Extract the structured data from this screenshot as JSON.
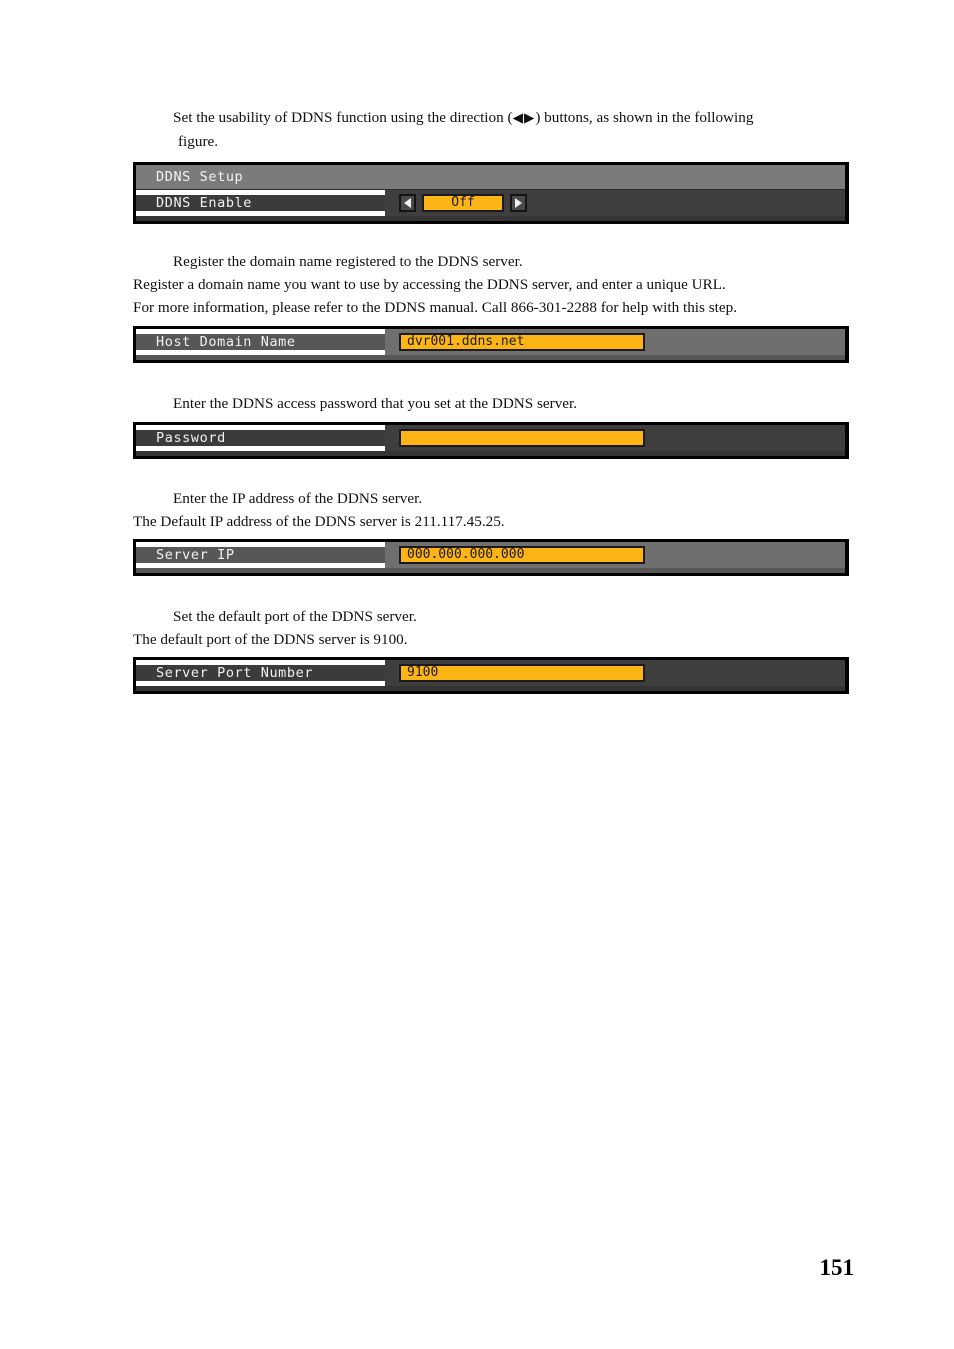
{
  "document": {
    "page_number": "151"
  },
  "sections": [
    {
      "id": "ddns-enable",
      "paragraph_lines": [
        "Set the usability of DDNS function using the direction (◀ ▶) buttons, as shown in the following",
        "figure."
      ],
      "para_pre": "Set the usability of DDNS function using the direction (",
      "para_arrows": "◀▶",
      "para_post": ") buttons, as shown in the following",
      "para_line2": "figure.",
      "panel": {
        "header_label": "DDNS Setup",
        "row_label": "DDNS Enable",
        "value": "Off",
        "left_arrow": "◀",
        "right_arrow": "▶"
      }
    },
    {
      "id": "host-domain-name",
      "lines": [
        "Register the domain name registered to the DDNS server.",
        "Register a domain name you want to use by accessing the DDNS server, and enter a unique URL.",
        "For more information, please refer to the DDNS manual. Call 866-301-2288 for help with this step."
      ],
      "panel": {
        "row_label": "Host Domain Name",
        "value": "dvr001.ddns.net"
      }
    },
    {
      "id": "password",
      "lines": [
        "Enter the DDNS access password that you set at the DDNS server."
      ],
      "panel": {
        "row_label": "Password",
        "value": ""
      }
    },
    {
      "id": "server-ip",
      "lines": [
        "Enter the IP address of the DDNS server.",
        "The Default IP address of the DDNS server is 211.117.45.25."
      ],
      "panel": {
        "row_label": "Server IP",
        "value": "000.000.000.000"
      }
    },
    {
      "id": "server-port-number",
      "lines": [
        "Set the default port of the DDNS server.",
        "The default port of the DDNS server is 9100."
      ],
      "panel": {
        "row_label": "Server Port Number",
        "value": "9100"
      }
    }
  ],
  "colors": {
    "osd_orange": "#fdb515",
    "osd_header_gray": "#7b7b7b",
    "osd_light_gray": "#6f6f6f",
    "osd_dark_gray": "#3e3e3e",
    "osd_border": "#000000"
  }
}
